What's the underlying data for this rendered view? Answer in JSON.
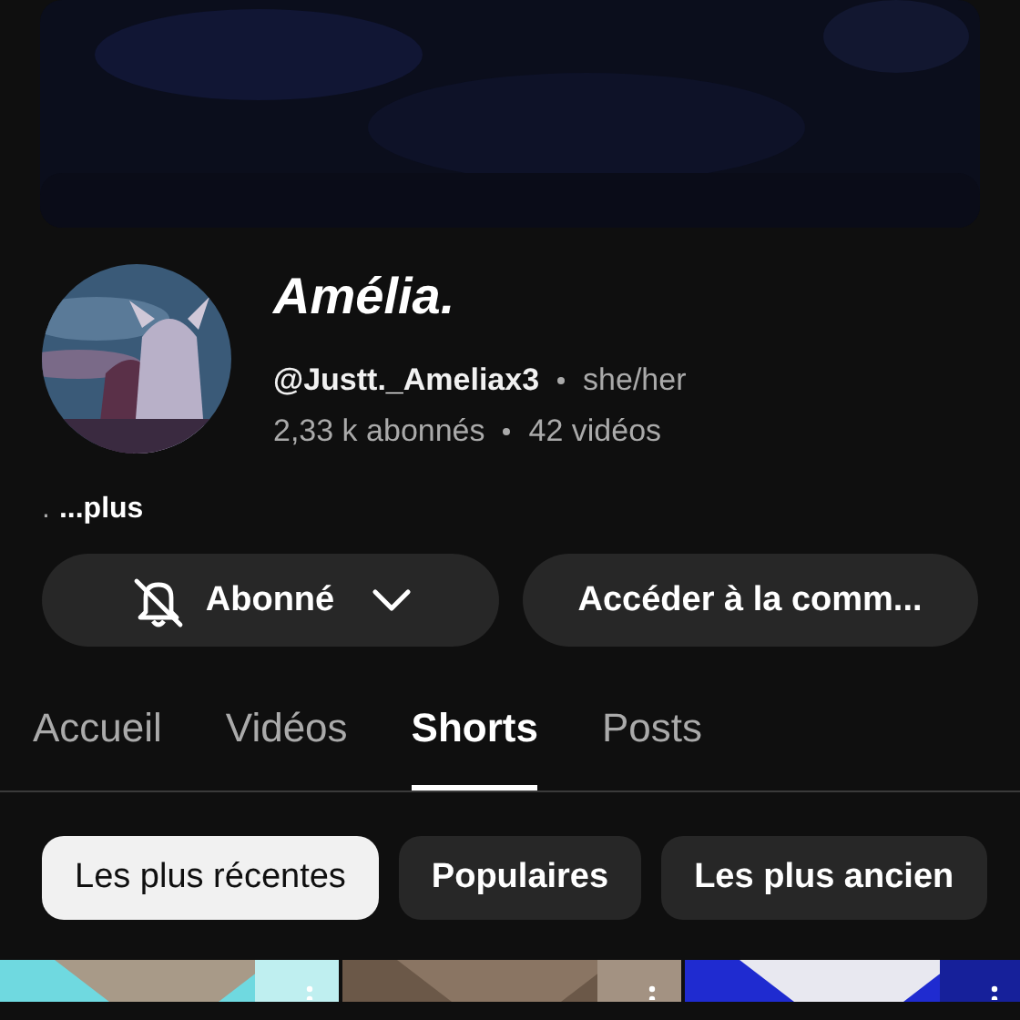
{
  "channel": {
    "name": "Amélia.",
    "handle": "@Justt._Ameliax3",
    "pronouns": "she/her",
    "subscribers": "2,33 k abonnés",
    "videos": "42 vidéos"
  },
  "description": {
    "text": ".",
    "more": "...plus"
  },
  "actions": [
    {
      "kind": "subscribed",
      "label": "Abonné"
    },
    {
      "kind": "plain",
      "label": "Accéder à la comm..."
    }
  ],
  "tabs": [
    {
      "label": "Accueil",
      "selected": false
    },
    {
      "label": "Vidéos",
      "selected": false
    },
    {
      "label": "Shorts",
      "selected": true
    },
    {
      "label": "Posts",
      "selected": false
    }
  ],
  "chips": [
    {
      "label": "Les plus récentes",
      "selected": true
    },
    {
      "label": "Populaires",
      "selected": false
    },
    {
      "label": "Les plus ancien",
      "selected": false
    }
  ]
}
